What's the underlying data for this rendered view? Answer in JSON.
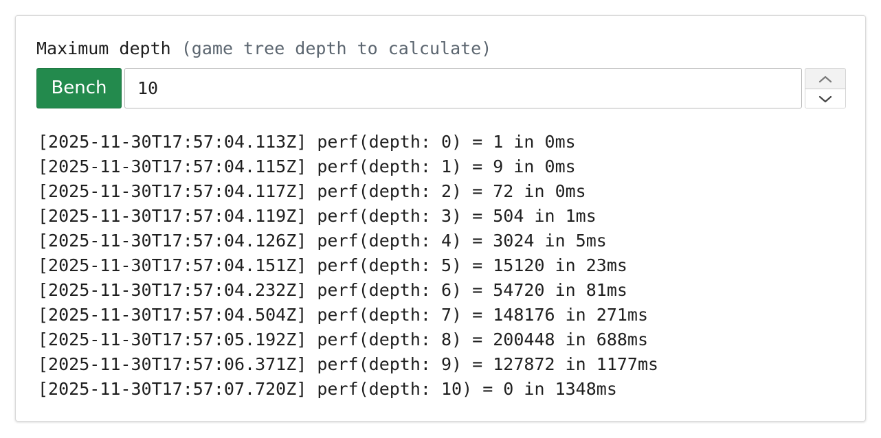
{
  "form": {
    "label": "Maximum depth",
    "hint": "(game tree depth to calculate)",
    "bench_label": "Bench",
    "depth_value": "10"
  },
  "stepper": {
    "up_icon": "chevron-up-icon",
    "down_icon": "chevron-down-icon"
  },
  "log": [
    "[2025-11-30T17:57:04.113Z] perf(depth: 0) = 1 in 0ms",
    "[2025-11-30T17:57:04.115Z] perf(depth: 1) = 9 in 0ms",
    "[2025-11-30T17:57:04.117Z] perf(depth: 2) = 72 in 0ms",
    "[2025-11-30T17:57:04.119Z] perf(depth: 3) = 504 in 1ms",
    "[2025-11-30T17:57:04.126Z] perf(depth: 4) = 3024 in 5ms",
    "[2025-11-30T17:57:04.151Z] perf(depth: 5) = 15120 in 23ms",
    "[2025-11-30T17:57:04.232Z] perf(depth: 6) = 54720 in 81ms",
    "[2025-11-30T17:57:04.504Z] perf(depth: 7) = 148176 in 271ms",
    "[2025-11-30T17:57:05.192Z] perf(depth: 8) = 200448 in 688ms",
    "[2025-11-30T17:57:06.371Z] perf(depth: 9) = 127872 in 1177ms",
    "[2025-11-30T17:57:07.720Z] perf(depth: 10) = 0 in 1348ms"
  ],
  "colors": {
    "bench_green": "#238a4d",
    "hint_gray": "#5c6670"
  }
}
